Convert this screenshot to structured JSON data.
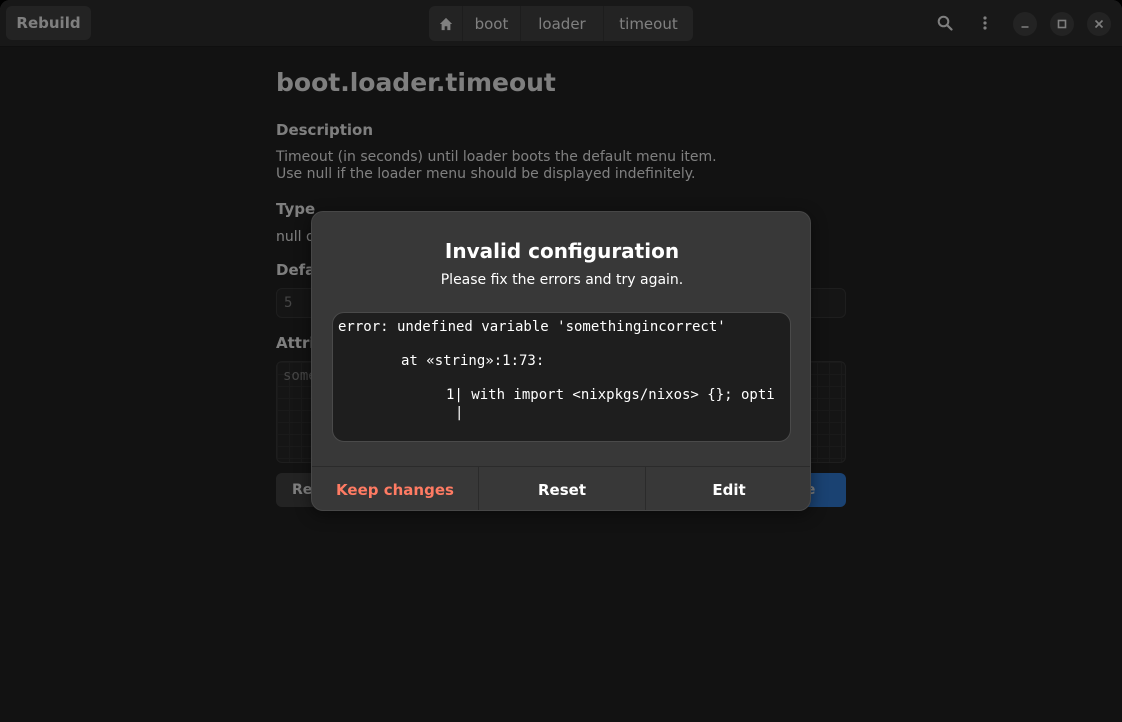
{
  "header": {
    "rebuild_label": "Rebuild",
    "breadcrumbs": [
      "boot",
      "loader",
      "timeout"
    ],
    "icons": [
      "home-icon",
      "search-icon",
      "menu-icon",
      "minimize-icon",
      "maximize-icon",
      "close-icon"
    ]
  },
  "option": {
    "title": "boot.loader.timeout",
    "description_heading": "Description",
    "description_line1": "Timeout (in seconds) until loader boots the default menu item.",
    "description_line2": "Use null if the loader menu should be displayed indefinitely.",
    "type_heading": "Type",
    "type_value": "null o",
    "default_heading": "Defau",
    "default_value": "5",
    "attribute_heading": "Attrib",
    "attribute_placeholder": "some",
    "reset_partial": "Re",
    "save_partial": "ve"
  },
  "dialog": {
    "title": "Invalid configuration",
    "body": "Please fix the errors and try again.",
    "error_lines": [
      "error: undefined variable 'somethingincorrect'",
      "at «string»:1:73:",
      "1| with import <nixpkgs/nixos> {}; opti",
      "|"
    ],
    "buttons": {
      "keep": "Keep changes",
      "reset": "Reset",
      "edit": "Edit"
    }
  },
  "colors": {
    "accent": "#3584e4",
    "destructive": "#ff7b63",
    "window_bg": "#242424",
    "dialog_bg": "#383838"
  }
}
